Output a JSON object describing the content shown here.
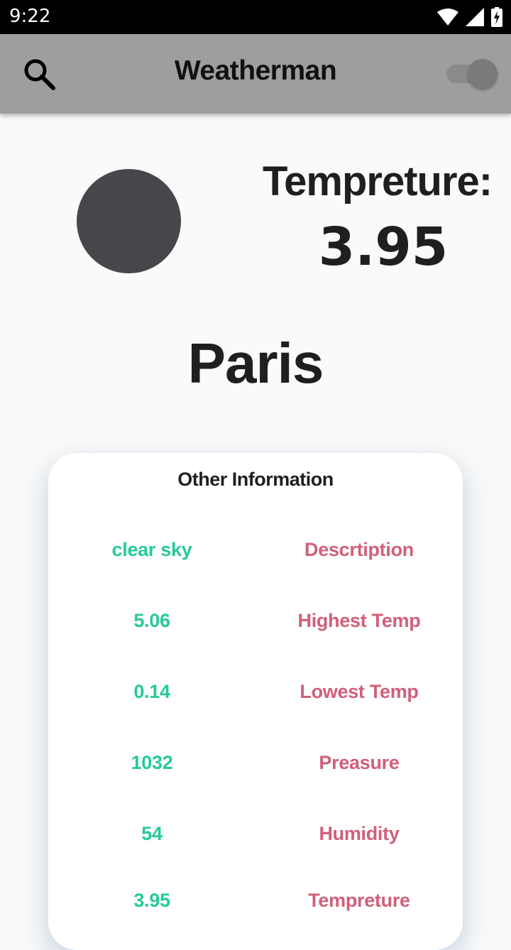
{
  "status_bar": {
    "time": "9:22"
  },
  "app_bar": {
    "title": "Weatherman",
    "toggle_on": true
  },
  "current": {
    "temp_label": "Tempreture:",
    "temp_value": "3.95",
    "city": "Paris"
  },
  "card": {
    "title": "Other Information",
    "rows": [
      {
        "value": "clear sky",
        "label": "Descrtiption"
      },
      {
        "value": "5.06",
        "label": "Highest Temp"
      },
      {
        "value": "0.14",
        "label": "Lowest Temp"
      },
      {
        "value": "1032",
        "label": "Preasure"
      },
      {
        "value": "54",
        "label": "Humidity"
      },
      {
        "value": "3.95",
        "label": "Tempreture"
      }
    ]
  },
  "colors": {
    "app_bar": "#9e9e9e",
    "value_text": "#26c99a",
    "label_text": "#d0607a",
    "weather_icon": "#47474b"
  }
}
